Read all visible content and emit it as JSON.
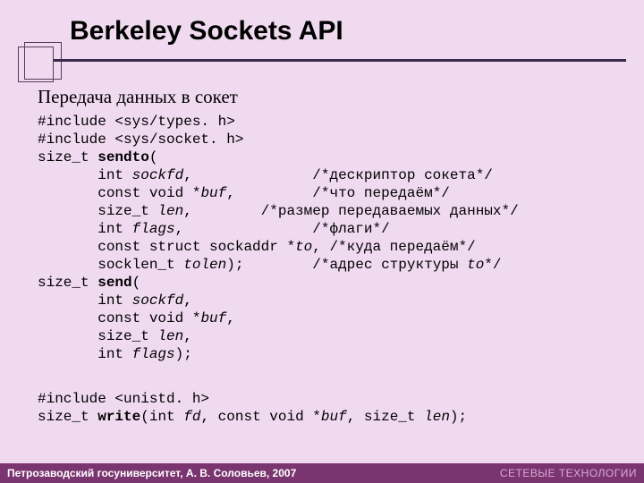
{
  "title": "Berkeley Sockets API",
  "subtitle": "Передача данных в сокет",
  "code_block_1": {
    "l1": "#include <sys/types. h>",
    "l2": "#include <sys/socket. h>",
    "l3a": "size_t ",
    "l3b": "sendto",
    "l3c": "(",
    "l4a": "       int ",
    "l4b": "sockfd",
    "l4c": ",              /*дескриптор сокета*/",
    "l5a": "       const void *",
    "l5b": "buf",
    "l5c": ",         /*что передаём*/",
    "l6a": "       size_t ",
    "l6b": "len",
    "l6c": ",        /*размер передаваемых данных*/",
    "l7a": "       int ",
    "l7b": "flags",
    "l7c": ",               /*флаги*/",
    "l8a": "       const struct sockaddr *",
    "l8b": "to",
    "l8c": ", /*куда передаём*/",
    "l9a": "       socklen_t ",
    "l9b": "tolen",
    "l9c": ");        /*адрес структуры ",
    "l9d": "to",
    "l9e": "*/",
    "l10a": "size_t ",
    "l10b": "send",
    "l10c": "(",
    "l11a": "       int ",
    "l11b": "sockfd",
    "l11c": ",",
    "l12a": "       const void *",
    "l12b": "buf",
    "l12c": ",",
    "l13a": "       size_t ",
    "l13b": "len",
    "l13c": ",",
    "l14a": "       int ",
    "l14b": "flags",
    "l14c": ");"
  },
  "code_block_2": {
    "l1": "#include <unistd. h>",
    "l2a": "size_t ",
    "l2b": "write",
    "l2c": "(int ",
    "l2d": "fd",
    "l2e": ", const void *",
    "l2f": "buf",
    "l2g": ", size_t ",
    "l2h": "len",
    "l2i": ");"
  },
  "footer": {
    "left": "Петрозаводский госуниверситет, А. В. Соловьев, 2007",
    "right": "СЕТЕВЫЕ ТЕХНОЛОГИИ"
  }
}
